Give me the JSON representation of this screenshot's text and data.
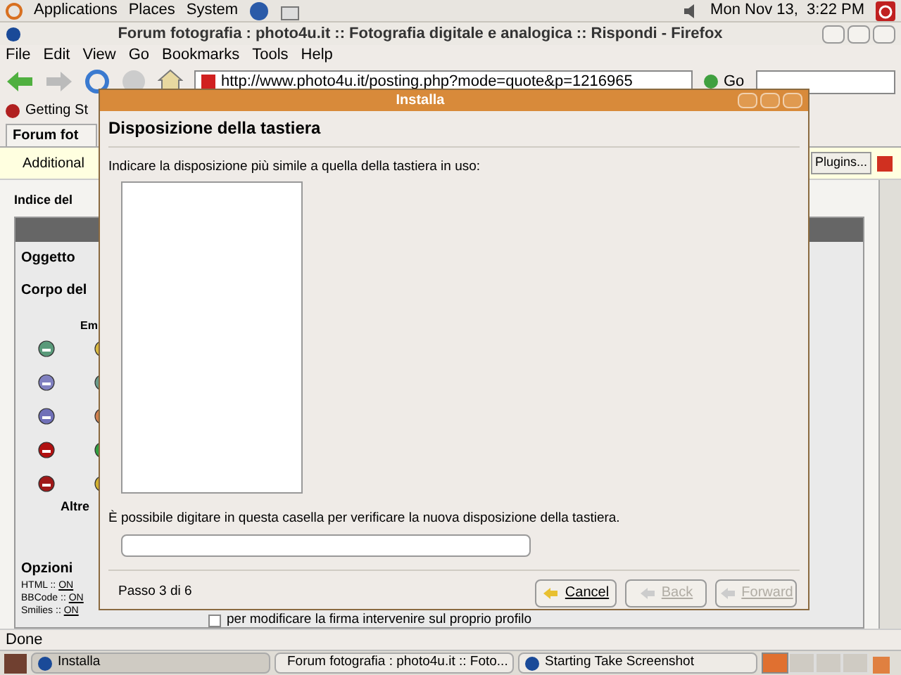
{
  "top_panel": {
    "menus": [
      "Applications",
      "Places",
      "System"
    ],
    "clock": "Mon Nov 13,  3:22 PM"
  },
  "browser": {
    "title": "Forum fotografia : photo4u.it :: Fotografia digitale e analogica :: Rispondi - Firefox",
    "menu": [
      "File",
      "Edit",
      "View",
      "Go",
      "Bookmarks",
      "Tools",
      "Help"
    ],
    "url": "http://www.photo4u.it/posting.php?mode=quote&p=1216965",
    "go": "Go",
    "bookmarks": [
      "Getting St"
    ],
    "tabs": [
      {
        "label": "Forum fot",
        "selected": true
      }
    ],
    "infobar": {
      "message": "Additional",
      "button": "Plugins..."
    },
    "page": {
      "breadcrumb": "Indice del",
      "subject": "Oggetto",
      "body": "Corpo del",
      "emoticons": "Em",
      "more": "Altre",
      "options_title": "Opzioni",
      "options": [
        {
          "label": "HTML :: ",
          "value": "ON"
        },
        {
          "label": "BBCode :: ",
          "value": "ON"
        },
        {
          "label": "Smilies :: ",
          "value": "ON"
        }
      ],
      "checkbox_rows": [
        {
          "label": "per modificare la firma intervenire sul proprio profilo",
          "checked": false
        }
      ]
    },
    "status": "Done"
  },
  "dialog": {
    "title": "Installa",
    "heading": "Disposizione della tastiera",
    "prompt": "Indicare la disposizione più simile a quella della tastiera in uso:",
    "test_label": "È possibile digitare in questa casella per verificare la nuova disposizione della tastiera.",
    "step": "Passo 3 di 6",
    "buttons": [
      {
        "label": "Cancel",
        "disabled": false
      },
      {
        "label": "Back",
        "disabled": true
      },
      {
        "label": "Forward",
        "disabled": true
      }
    ]
  },
  "taskbar": [
    {
      "label": "Installa",
      "selected": true
    },
    {
      "label": "Forum fotografia : photo4u.it :: Foto...",
      "selected": false
    },
    {
      "label": "Starting Take Screenshot",
      "selected": false
    }
  ],
  "workspaces": [
    {
      "selected": true
    },
    {
      "selected": false
    },
    {
      "selected": false
    },
    {
      "selected": false
    }
  ]
}
